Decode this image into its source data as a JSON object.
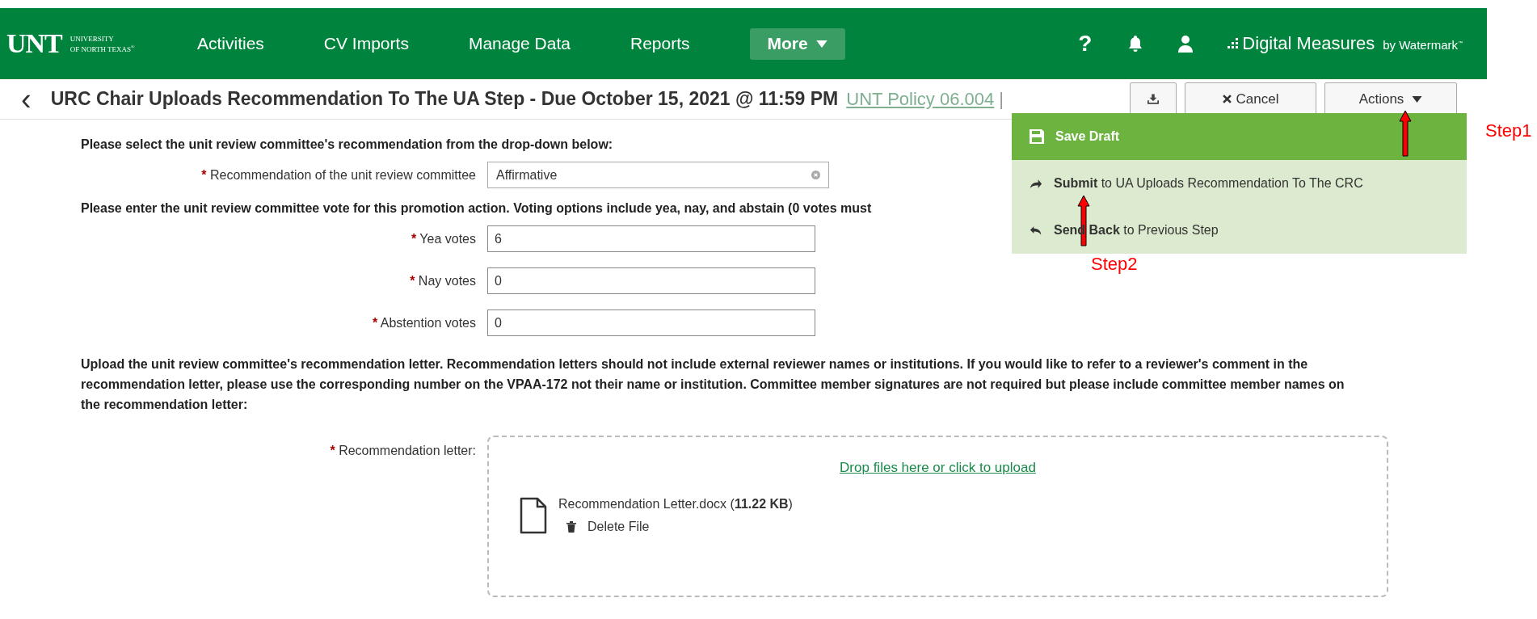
{
  "nav": {
    "logo": {
      "mark": "UNT",
      "line1": "UNIVERSITY",
      "line2": "OF NORTH TEXAS",
      "reg": "®"
    },
    "items": [
      {
        "label": "Activities",
        "kind": "link"
      },
      {
        "label": "CV Imports",
        "kind": "link"
      },
      {
        "label": "Manage Data",
        "kind": "link"
      },
      {
        "label": "Reports",
        "kind": "link"
      },
      {
        "label": "More",
        "kind": "dropdown"
      }
    ],
    "help": "?",
    "brand": {
      "name": "Digital Measures",
      "by": "by Watermark",
      "tm": "™"
    }
  },
  "header": {
    "back": "‹",
    "title": "URC Chair Uploads Recommendation To The UA Step - Due October 15, 2021 @ 11:59 PM",
    "links": [
      {
        "label": "UNT Policy 06.004"
      }
    ],
    "separator": "|",
    "cancel": "Cancel",
    "actions": "Actions"
  },
  "menu": [
    {
      "kind": "save",
      "bold": "Save Draft"
    },
    {
      "kind": "submit",
      "bold": "Submit",
      "rest": " to UA Uploads Recommendation To The CRC"
    },
    {
      "kind": "back",
      "bold": "Send Back",
      "rest": " to Previous Step"
    }
  ],
  "form": {
    "select_heading": "Please select the unit review committee's recommendation from the drop-down below:",
    "recommendation": {
      "mark": "*",
      "label": "Recommendation of the unit review committee",
      "value": "Affirmative"
    },
    "vote_heading": "Please enter the unit review committee vote for this promotion action.  Voting options include yea, nay, and abstain (0 votes must",
    "votes": [
      {
        "mark": "*",
        "label": "Yea votes",
        "value": "6"
      },
      {
        "mark": "*",
        "label": "Nay votes",
        "value": "0"
      },
      {
        "mark": "*",
        "label": "Abstention votes",
        "value": "0"
      }
    ],
    "upload_heading": "Upload the unit review committee's recommendation letter. Recommendation letters should not include external reviewer names or institutions.  If you would like to refer to a reviewer's comment in the recommendation letter, please use the corresponding number on the VPAA-172 not their name or institution. Committee member signatures are not required but please include committee member names on the recommendation letter:",
    "letter": {
      "mark": "*",
      "label": "Recommendation letter:",
      "drop": "Drop files here or click to upload",
      "file": "Recommendation Letter.docx (**11.22 KB**)",
      "delete": "Delete File"
    }
  },
  "annotations": [
    {
      "label": "Step1"
    },
    {
      "label": "Step2"
    }
  ]
}
